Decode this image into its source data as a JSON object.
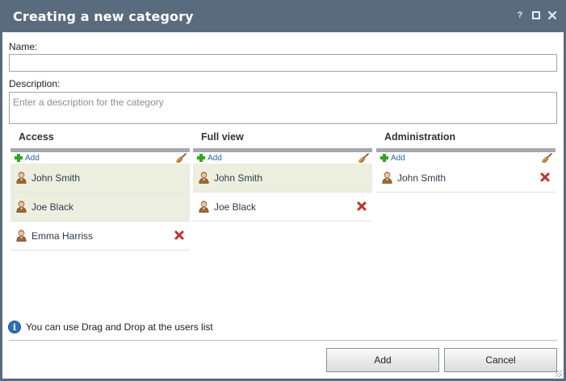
{
  "dialog": {
    "title": "Creating a new category",
    "controls": {
      "help": "?",
      "maximize": "maximize",
      "close": "close"
    }
  },
  "form": {
    "name_label": "Name:",
    "name_value": "",
    "description_label": "Description:",
    "description_placeholder": "Enter a description for the category",
    "description_value": ""
  },
  "panels": [
    {
      "title": "Access",
      "add_label": "Add",
      "users": [
        {
          "name": "John Smith",
          "shaded": true,
          "removable": false
        },
        {
          "name": "Joe Black",
          "shaded": true,
          "removable": false
        },
        {
          "name": "Emma Harriss",
          "shaded": false,
          "removable": true
        }
      ]
    },
    {
      "title": "Full view",
      "add_label": "Add",
      "users": [
        {
          "name": "John Smith",
          "shaded": true,
          "removable": false
        },
        {
          "name": "Joe Black",
          "shaded": false,
          "removable": true
        }
      ]
    },
    {
      "title": "Administration",
      "add_label": "Add",
      "users": [
        {
          "name": "John Smith",
          "shaded": false,
          "removable": true
        }
      ]
    }
  ],
  "hint": "You can use Drag and Drop at the users list",
  "buttons": {
    "add": "Add",
    "cancel": "Cancel"
  },
  "icons": {
    "add": "plus-icon",
    "clear": "broom-icon",
    "user": "user-icon",
    "remove": "remove-icon",
    "info": "info-icon"
  },
  "colors": {
    "titlebar": "#5a6b7e",
    "shaded_row": "#ecefdf",
    "add_link": "#2a62b0",
    "remove": "#c4302a"
  }
}
